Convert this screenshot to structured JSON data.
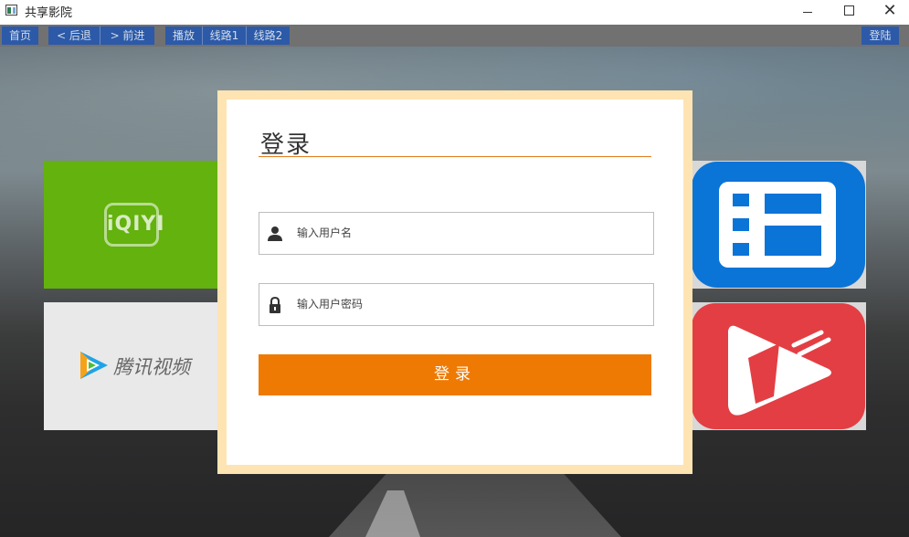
{
  "window": {
    "title": "共享影院",
    "controls": {
      "minimize": "—",
      "maximize": "☐",
      "close": "✕"
    }
  },
  "navbar": {
    "home": "首页",
    "back": "< 后退",
    "forward": "> 前进",
    "play": "播放",
    "line1": "线路1",
    "line2": "线路2",
    "login": "登陆"
  },
  "tiles": {
    "iqiyi": "iQIYI",
    "tencent": "腾讯视频"
  },
  "dialog": {
    "title": "登录",
    "username_placeholder": "输入用户名",
    "password_placeholder": "输入用户密码",
    "submit_label": "登录"
  },
  "colors": {
    "accent": "#ef7a03",
    "nav_button": "#2c5aa8",
    "frame": "#fde4b2",
    "iqiyi_green": "#63b20d",
    "blue_app": "#0b74d7",
    "red_app": "#e33e43"
  },
  "icons": [
    "user-icon",
    "lock-icon",
    "iqiyi-logo",
    "tencent-video-logo",
    "film-app-icon",
    "play-app-icon"
  ]
}
